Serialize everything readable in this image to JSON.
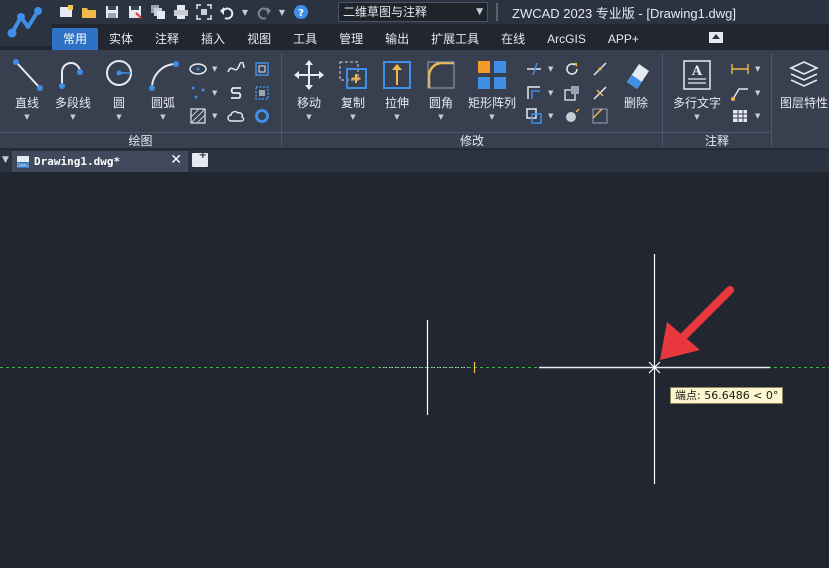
{
  "window": {
    "title": "ZWCAD 2023 专业版 - [Drawing1.dwg]"
  },
  "quick_access": {
    "workspace": "二维草图与注释",
    "icons": [
      "new-icon",
      "open-icon",
      "save-icon",
      "save-as-icon",
      "batch-plot-icon",
      "plot-icon",
      "zoom-extents-icon",
      "undo-icon",
      "redo-icon",
      "help-icon"
    ]
  },
  "ribbon": {
    "tabs": [
      {
        "label": "常用",
        "active": true
      },
      {
        "label": "实体"
      },
      {
        "label": "注释"
      },
      {
        "label": "插入"
      },
      {
        "label": "视图"
      },
      {
        "label": "工具"
      },
      {
        "label": "管理"
      },
      {
        "label": "输出"
      },
      {
        "label": "扩展工具"
      },
      {
        "label": "在线"
      },
      {
        "label": "ArcGIS"
      },
      {
        "label": "APP+"
      }
    ],
    "panels": {
      "draw": {
        "title": "绘图",
        "line": "直线",
        "polyline": "多段线",
        "circle": "圆",
        "arc": "圆弧"
      },
      "modify": {
        "title": "修改",
        "move": "移动",
        "copy": "复制",
        "stretch": "拉伸",
        "fillet": "圆角",
        "rect_array": "矩形阵列",
        "erase": "删除"
      },
      "annotation": {
        "title": "注释",
        "mtext": "多行文字"
      },
      "layers": {
        "layer_properties": "图层特性"
      }
    }
  },
  "document": {
    "tab_name": "Drawing1.dwg*",
    "close_symbol": "✕"
  },
  "canvas": {
    "tooltip": "端点: 56.6486 < 0°",
    "colors": {
      "background": "#212630",
      "polar_track": "#3bb34a",
      "geometry": "#ffffff",
      "arrow": "#e8383d",
      "tooltip_bg": "#fdf6cf"
    }
  }
}
